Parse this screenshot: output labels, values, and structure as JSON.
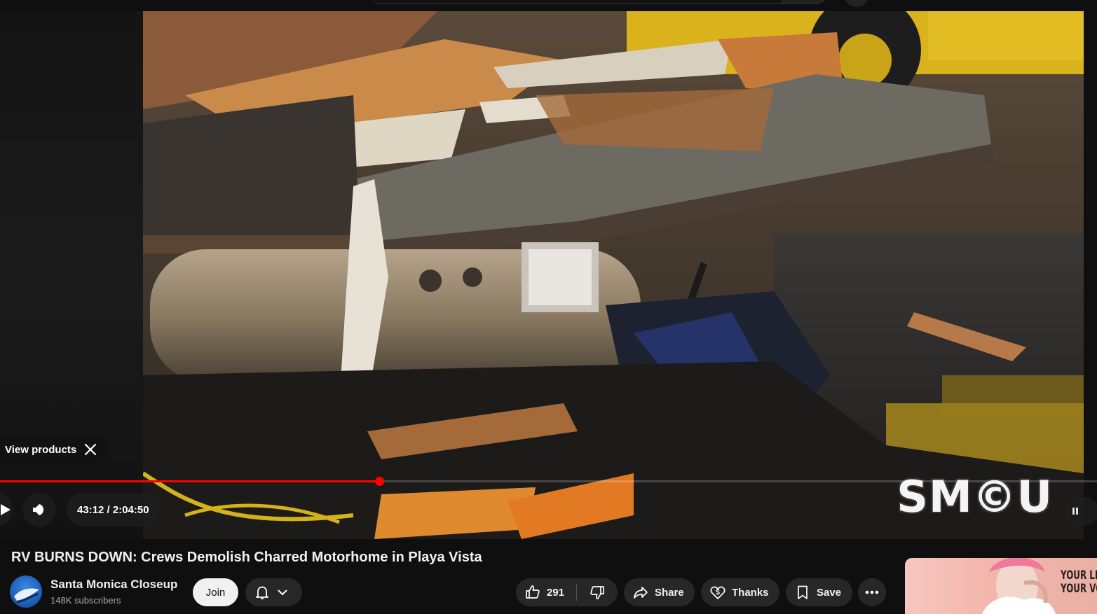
{
  "player": {
    "view_products_label": "View products",
    "time_display": "43:12 / 2:04:50",
    "progress_fraction": 0.3455,
    "watermark": "SMCU",
    "watermark_display": "SM©U"
  },
  "video": {
    "title": "RV BURNS DOWN: Crews Demolish Charred Motorhome in Playa Vista"
  },
  "channel": {
    "name": "Santa Monica Closeup",
    "subscribers": "148K subscribers",
    "join_label": "Join"
  },
  "actions": {
    "like_count": "291",
    "share_label": "Share",
    "thanks_label": "Thanks",
    "save_label": "Save"
  },
  "ad": {
    "text_line1": "YOUR LIFE",
    "text_line2": "YOUR VOL"
  },
  "icons": {
    "play": "play-icon",
    "volume": "volume-icon",
    "close": "close-icon",
    "bell": "bell-icon",
    "chevron": "chevron-down-icon",
    "like": "thumbs-up-icon",
    "dislike": "thumbs-down-icon",
    "share": "share-arrow-icon",
    "thanks": "thanks-dollar-icon",
    "save": "bookmark-icon",
    "more": "more-horizontal-icon"
  },
  "colors": {
    "progress_played": "#ff0000",
    "background": "#0f0f0f",
    "pill": "#272727"
  }
}
